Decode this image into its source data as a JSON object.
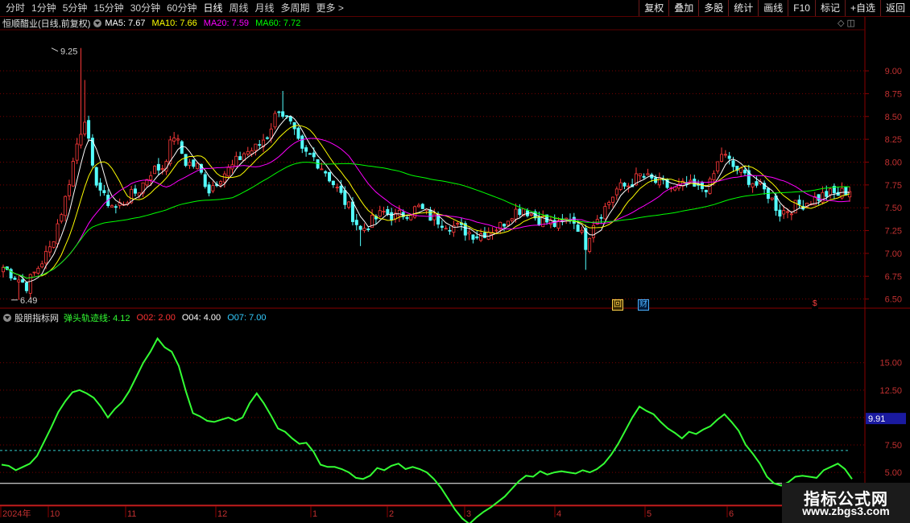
{
  "toolbar": {
    "periods": [
      "分时",
      "1分钟",
      "5分钟",
      "15分钟",
      "30分钟",
      "60分钟",
      "日线",
      "周线",
      "月线",
      "多周期",
      "更多 >"
    ],
    "active_period": "日线",
    "buttons": [
      "复权",
      "叠加",
      "多股",
      "统计",
      "画线",
      "F10",
      "标记",
      "+自选",
      "返回"
    ]
  },
  "main_header": {
    "stock": "恒顺醋业(日线,前复权)",
    "ma": [
      {
        "label": "MA5: 7.67",
        "color": "#ffffff"
      },
      {
        "label": "MA10: 7.66",
        "color": "#ffff00"
      },
      {
        "label": "MA20: 7.59",
        "color": "#ff00ff"
      },
      {
        "label": "MA60: 7.72",
        "color": "#00ff00"
      }
    ],
    "icons": "◇ ◫"
  },
  "indicator_header": {
    "name": "股朋指标网",
    "values": [
      {
        "label": "弹头轨迹线: 4.12",
        "color": "#33ff33"
      },
      {
        "label": "O02: 2.00",
        "color": "#ff3333"
      },
      {
        "label": "O04: 4.00",
        "color": "#ffffff"
      },
      {
        "label": "O07: 7.00",
        "color": "#33ccff"
      }
    ]
  },
  "badges": [
    {
      "text": "回",
      "color": "#ffd24a",
      "bg": "#3a2a00"
    },
    {
      "text": "财",
      "color": "#4ab0ff",
      "bg": "#001a3a"
    },
    {
      "text": "$",
      "color": "#ff4040",
      "bg": "#000000"
    }
  ],
  "watermark": {
    "title": "指标公式网",
    "url": "www.zbgs3.com"
  },
  "chart_data": [
    {
      "type": "candlestick",
      "title": "恒顺醋业(日线,前复权)",
      "ylim": [
        6.4,
        9.45
      ],
      "yticks": [
        6.5,
        6.75,
        7.0,
        7.25,
        7.5,
        7.75,
        8.0,
        8.25,
        8.5,
        8.75,
        9.0
      ],
      "annotations": [
        {
          "label": "9.25",
          "value": 9.25
        },
        {
          "label": "6.49",
          "value": 6.49
        }
      ],
      "x_labels": [
        "2024年",
        "10",
        "11",
        "12",
        "1",
        "2",
        "3",
        "4",
        "5",
        "6"
      ],
      "ma_values": {
        "MA5": 7.67,
        "MA10": 7.66,
        "MA20": 7.59,
        "MA60": 7.72
      },
      "close_keypoints": [
        [
          0,
          6.85
        ],
        [
          6,
          6.65
        ],
        [
          12,
          7.05
        ],
        [
          16,
          7.6
        ],
        [
          19,
          8.2
        ],
        [
          21,
          8.5
        ],
        [
          23,
          7.9
        ],
        [
          26,
          7.6
        ],
        [
          29,
          7.5
        ],
        [
          32,
          7.6
        ],
        [
          35,
          7.7
        ],
        [
          38,
          7.9
        ],
        [
          41,
          7.95
        ],
        [
          44,
          8.3
        ],
        [
          47,
          8.0
        ],
        [
          50,
          7.95
        ],
        [
          53,
          7.7
        ],
        [
          56,
          7.85
        ],
        [
          59,
          7.95
        ],
        [
          62,
          8.1
        ],
        [
          65,
          8.15
        ],
        [
          68,
          8.3
        ],
        [
          71,
          8.6
        ],
        [
          74,
          8.4
        ],
        [
          77,
          8.1
        ],
        [
          80,
          8.05
        ],
        [
          83,
          7.9
        ],
        [
          86,
          7.7
        ],
        [
          89,
          7.5
        ],
        [
          92,
          7.25
        ],
        [
          95,
          7.35
        ],
        [
          98,
          7.45
        ],
        [
          101,
          7.4
        ],
        [
          104,
          7.45
        ],
        [
          107,
          7.5
        ],
        [
          110,
          7.4
        ],
        [
          113,
          7.35
        ],
        [
          116,
          7.3
        ],
        [
          119,
          7.25
        ],
        [
          122,
          7.2
        ],
        [
          125,
          7.25
        ],
        [
          128,
          7.3
        ],
        [
          131,
          7.45
        ],
        [
          134,
          7.5
        ],
        [
          137,
          7.4
        ],
        [
          140,
          7.35
        ],
        [
          143,
          7.3
        ],
        [
          146,
          7.4
        ],
        [
          148,
          7.3
        ],
        [
          150,
          7.1
        ],
        [
          152,
          7.35
        ],
        [
          155,
          7.5
        ],
        [
          158,
          7.7
        ],
        [
          161,
          7.75
        ],
        [
          164,
          7.85
        ],
        [
          167,
          7.8
        ],
        [
          170,
          7.75
        ],
        [
          173,
          7.7
        ],
        [
          176,
          7.75
        ],
        [
          179,
          7.7
        ],
        [
          182,
          7.75
        ],
        [
          185,
          8.1
        ],
        [
          188,
          7.95
        ],
        [
          191,
          7.85
        ],
        [
          194,
          7.75
        ],
        [
          197,
          7.65
        ],
        [
          200,
          7.45
        ],
        [
          203,
          7.5
        ],
        [
          206,
          7.55
        ],
        [
          209,
          7.6
        ],
        [
          212,
          7.65
        ],
        [
          215,
          7.65
        ],
        [
          218,
          7.7
        ]
      ]
    },
    {
      "type": "line",
      "title": "股朋指标网",
      "ylim": [
        2.0,
        18.5
      ],
      "yticks": [
        5.0,
        7.5,
        10.0,
        12.5,
        15.0
      ],
      "current_label": "9.91",
      "reference_lines": [
        {
          "name": "O02",
          "value": 2.0,
          "color": "#ff3333"
        },
        {
          "name": "O04",
          "value": 4.0,
          "color": "#ffffff"
        },
        {
          "name": "O07",
          "value": 7.0,
          "color": "#33cccc"
        }
      ],
      "series": [
        {
          "name": "弹头轨迹线",
          "values": [
            5.7,
            5.6,
            5.2,
            5.5,
            5.8,
            6.5,
            7.8,
            9.1,
            10.5,
            11.5,
            12.3,
            12.5,
            12.2,
            11.8,
            11.0,
            10.0,
            10.8,
            11.4,
            12.4,
            13.7,
            15.0,
            16.0,
            17.2,
            16.4,
            16.0,
            14.7,
            12.4,
            10.4,
            10.1,
            9.7,
            9.6,
            9.8,
            10.0,
            9.7,
            10.0,
            11.3,
            12.2,
            11.3,
            10.2,
            9.0,
            8.7,
            8.1,
            7.6,
            7.7,
            6.9,
            5.7,
            5.5,
            5.5,
            5.3,
            5.0,
            4.5,
            4.4,
            4.7,
            5.4,
            5.2,
            5.6,
            5.8,
            5.3,
            5.5,
            5.3,
            5.0,
            4.4,
            3.6,
            2.6,
            1.6,
            0.8,
            0.3,
            0.9,
            1.4,
            1.8,
            2.3,
            2.8,
            3.5,
            4.2,
            4.7,
            4.6,
            5.1,
            4.8,
            5.0,
            5.1,
            5.0,
            4.9,
            5.2,
            5.0,
            5.3,
            5.8,
            6.6,
            7.6,
            8.8,
            10.0,
            11.0,
            10.6,
            10.3,
            9.6,
            9.0,
            8.6,
            8.1,
            8.7,
            8.5,
            8.9,
            9.2,
            9.8,
            10.3,
            9.6,
            8.8,
            7.5,
            6.7,
            5.8,
            4.6,
            4.0,
            3.8,
            4.1,
            4.6,
            4.7,
            4.6,
            4.5,
            5.2,
            5.5,
            5.8,
            5.3,
            4.4
          ]
        }
      ]
    }
  ]
}
